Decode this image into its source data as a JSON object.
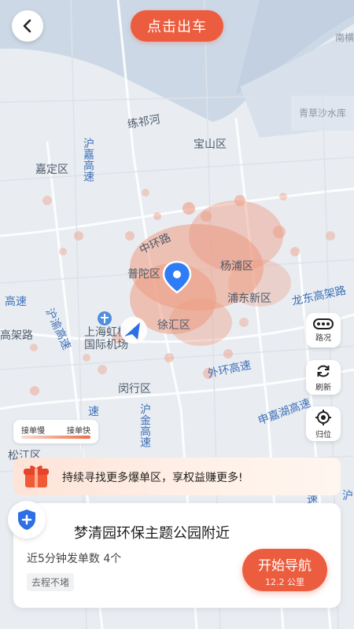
{
  "header": {
    "depart_label": "点击出车"
  },
  "map": {
    "labels": {
      "nanheng": "南横",
      "qingcao": "青草沙水库",
      "lianqihe": "练祁河",
      "baoshan": "宝山区",
      "jiading": "嘉定区",
      "hujia_hwy": "沪嘉高速",
      "zhonghuan": "中环路",
      "yangpu": "杨浦区",
      "putuo": "普陀区",
      "pudong": "浦东新区",
      "longdong": "龙东高架路",
      "gaosu": "高速",
      "gaojialu": "高架路",
      "huyu_hwy": "沪渝高速",
      "hongqiao": "上海虹桥国际机场",
      "xuhui": "徐汇区",
      "waihuan": "外环高速",
      "shenjiahu": "申嘉湖高速",
      "minhang": "闵行区",
      "hujin_hwy": "沪金高速",
      "songjiang": "松江区",
      "su": "速",
      "hu": "沪"
    }
  },
  "tools": {
    "traffic_label": "路况",
    "refresh_label": "刷新",
    "locate_label": "归位"
  },
  "legend": {
    "slow_label": "接单慢",
    "fast_label": "接单快"
  },
  "promo": {
    "text": "持续寻找更多爆单区，享权益赚更多!"
  },
  "destination": {
    "title": "梦清园环保主题公园附近",
    "orders_text": "近5分钟发单数 4个",
    "route_tag": "去程不堵",
    "nav_label": "开始导航",
    "distance": "12.2 公里"
  },
  "colors": {
    "accent": "#ec5d3f",
    "heat": "#ee9a80",
    "pin": "#2f7df6"
  }
}
